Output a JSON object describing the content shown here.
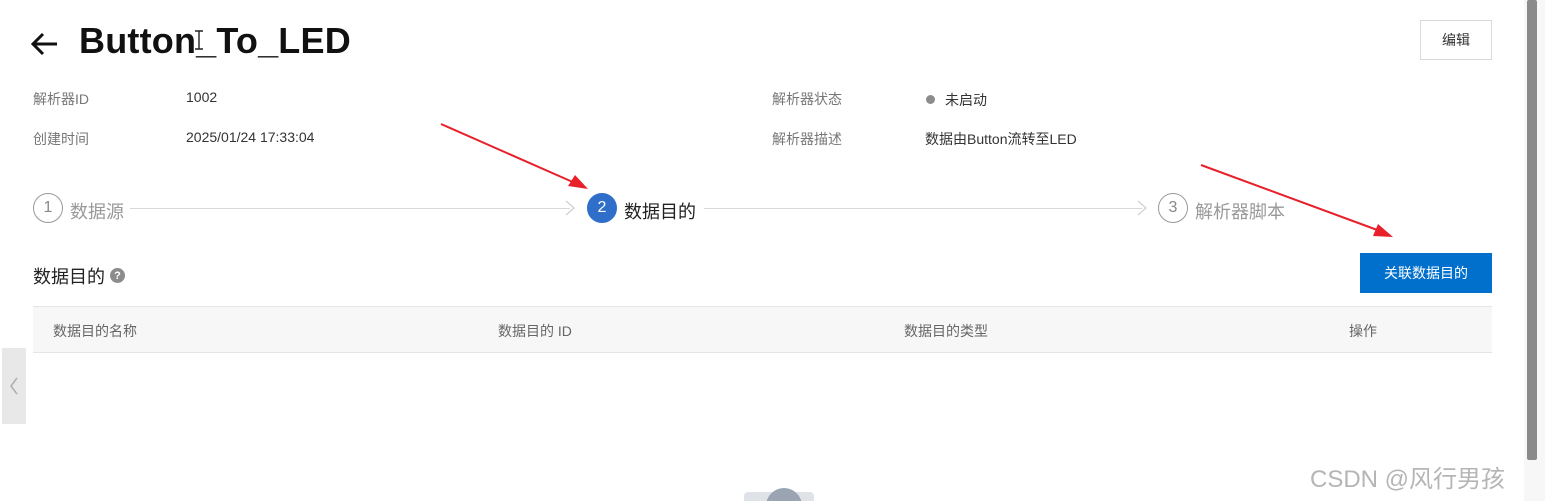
{
  "header": {
    "title": "Button_To_LED",
    "edit_label": "编辑"
  },
  "info": {
    "parser_id_label": "解析器ID",
    "parser_id_value": "1002",
    "created_label": "创建时间",
    "created_value": "2025/01/24 17:33:04",
    "status_label": "解析器状态",
    "status_value": "未启动",
    "desc_label": "解析器描述",
    "desc_value": "数据由Button流转至LED"
  },
  "steps": [
    {
      "num": "1",
      "label": "数据源",
      "active": false
    },
    {
      "num": "2",
      "label": "数据目的",
      "active": true
    },
    {
      "num": "3",
      "label": "解析器脚本",
      "active": false
    }
  ],
  "section": {
    "title": "数据目的",
    "help_glyph": "?",
    "action_label": "关联数据目的"
  },
  "table": {
    "columns": [
      "数据目的名称",
      "数据目的 ID",
      "数据目的类型",
      "操作"
    ],
    "rows": []
  },
  "watermark": "CSDN @风行男孩",
  "colors": {
    "primary": "#0070cc",
    "step_active": "#2f6fc9",
    "annotation_arrow": "#e8202a",
    "status_inactive": "#8c8c8c"
  }
}
